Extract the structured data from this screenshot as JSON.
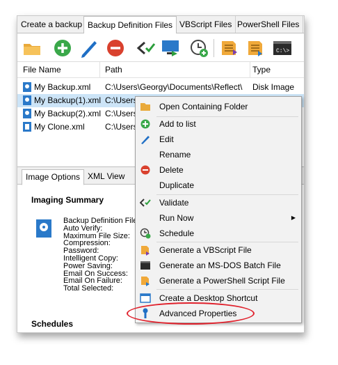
{
  "tabs": [
    "Create a backup",
    "Backup Definition Files",
    "VBScript Files",
    "PowerShell Files"
  ],
  "columns": [
    "File Name",
    "Path",
    "Type"
  ],
  "files": [
    {
      "name": "My Backup.xml",
      "path": "C:\\Users\\Georgy\\Documents\\Reflect\\",
      "type": "Disk Image"
    },
    {
      "name": "My Backup(1).xml",
      "path": "C:\\Users",
      "type": ""
    },
    {
      "name": "My Backup(2).xml",
      "path": "C:\\Users",
      "type": ""
    },
    {
      "name": "My Clone.xml",
      "path": "C:\\Users",
      "type": ""
    }
  ],
  "lower_tabs": [
    "Image Options",
    "XML View"
  ],
  "imaging_summary": "Imaging Summary",
  "summary_items": [
    "Backup Definition File",
    "Auto Verify:",
    "Maximum File Size:",
    "Compression:",
    "Password:",
    "Intelligent Copy:",
    "Power Saving:",
    "Email On Success:",
    "Email On Failure:",
    "Total Selected:"
  ],
  "schedules": "Schedules",
  "menu": {
    "open_folder": "Open Containing Folder",
    "add_to_list": "Add to list",
    "edit": "Edit",
    "rename": "Rename",
    "delete": "Delete",
    "duplicate": "Duplicate",
    "validate": "Validate",
    "run_now": "Run Now",
    "schedule": "Schedule",
    "gen_vbscript": "Generate a VBScript File",
    "gen_batch": "Generate an MS-DOS Batch File",
    "gen_powershell": "Generate a PowerShell Script File",
    "desktop_shortcut": "Create a Desktop Shortcut",
    "advanced": "Advanced Properties"
  },
  "colors": {
    "accent": "#0078d7",
    "highlight": "#e0202b",
    "selection": "#cce4f7"
  }
}
